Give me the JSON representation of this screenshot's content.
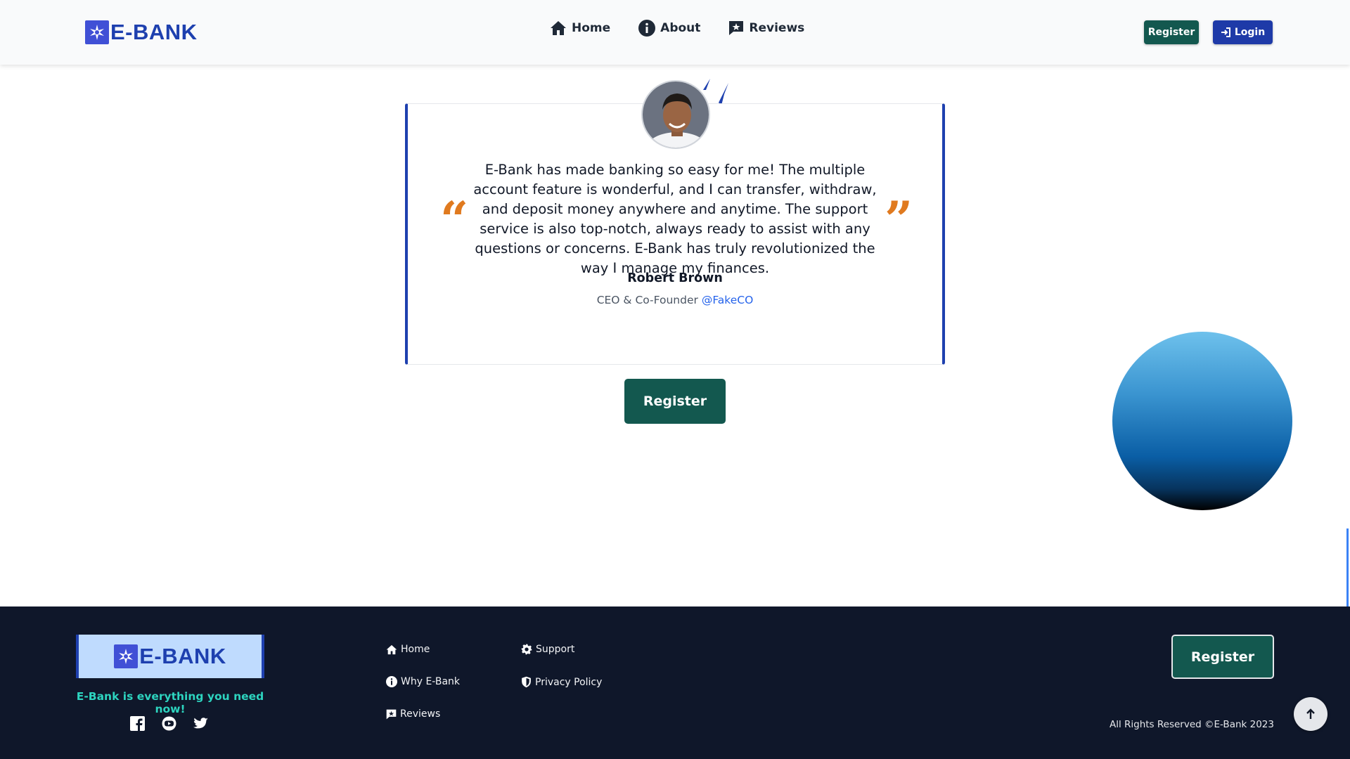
{
  "brand": {
    "name": "E-BANK",
    "icon": "bank-star-icon",
    "accent": "#1e40af"
  },
  "header": {
    "nav": [
      {
        "label": "Home",
        "icon": "home-icon"
      },
      {
        "label": "About",
        "icon": "info-icon"
      },
      {
        "label": "Reviews",
        "icon": "review-icon"
      }
    ],
    "register_label": "Register",
    "login_label": "Login"
  },
  "testimonial": {
    "avatar": "avatar",
    "text": "E-Bank has made banking so easy for me! The multiple account feature is wonderful, and I can transfer, withdraw, and deposit money anywhere and anytime. The support service is also top-notch, always ready to assist with any questions or concerns. E-Bank has truly revolutionized the way I manage my finances.",
    "author": "Robert Brown",
    "role": "CEO & Co-Founder",
    "handle": "@FakeCO",
    "open_quote": "“",
    "close_quote": "”",
    "quote_color": "#e07a1f"
  },
  "main": {
    "register_label": "Register"
  },
  "footer": {
    "logo_text": "E-BANK",
    "tagline": "E-Bank is everything you need now!",
    "socials": [
      "facebook-icon",
      "youtube-icon",
      "twitter-icon"
    ],
    "links_col1": [
      {
        "label": "Home",
        "icon": "home-icon"
      },
      {
        "label": "Why E-Bank",
        "icon": "info-icon"
      },
      {
        "label": "Reviews",
        "icon": "review-icon"
      }
    ],
    "links_col2": [
      {
        "label": "Support",
        "icon": "gear-icon"
      },
      {
        "label": "Privacy Policy",
        "icon": "shield-icon"
      }
    ],
    "register_label": "Register",
    "copyright": "All Rights Reserved ©E-Bank 2023"
  },
  "colors": {
    "primary_green": "#13584f",
    "primary_blue": "#1e3aa8",
    "footer_bg": "#0f172a",
    "tagline": "#2dd4bf"
  }
}
